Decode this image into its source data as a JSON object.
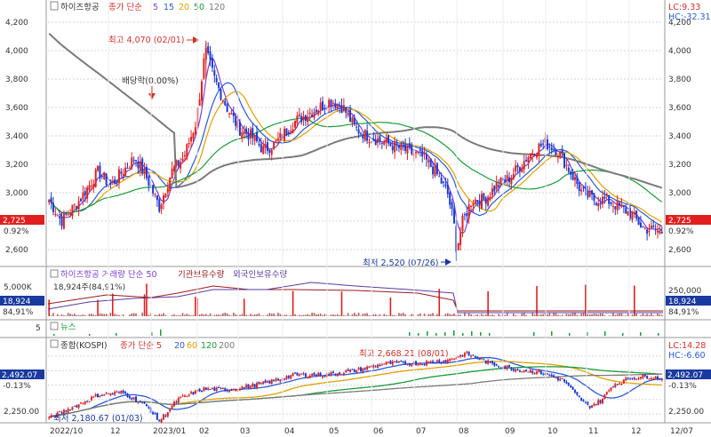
{
  "price": {
    "title": "하이즈항공",
    "ma_legend": [
      "종가 단순",
      "5",
      "15",
      "20",
      "50",
      "120"
    ],
    "ma_colors": {
      "5": "#7b3fd8",
      "15": "#2a5ad8",
      "20": "#e0a000",
      "50": "#1a9a3a",
      "120": "#7a7a7a"
    },
    "lc": "LC:9.33",
    "hc": "HC:-32.31",
    "current": "2,725",
    "change": "0.92%",
    "y_ticks": [
      "4,200",
      "4,000",
      "3,800",
      "3,600",
      "3,400",
      "3,200",
      "3,000",
      "2,800",
      "2,600"
    ],
    "high_label": "최고 4,070 (02/01)",
    "low_label": "최저 2,520 (07/26)",
    "dividend_label": "배당락(0.00%)"
  },
  "volume": {
    "legend": [
      "하이즈항공 거래량 단순 50",
      "기관보유수량",
      "외국인보유수량"
    ],
    "info": "18,924주(84,91%)",
    "tick_left": "5,000K",
    "tick_right": "250,000",
    "badge_vol": "18,924",
    "badge_pct": "84,91%"
  },
  "news": {
    "label": "뉴스",
    "tick": "5"
  },
  "index": {
    "title": "종합(KOSPI)",
    "legend": [
      "종가 단순 5",
      "20",
      "60",
      "120",
      "200"
    ],
    "legend_colors": [
      "#d0342c",
      "#2a5ad8",
      "#e0a000",
      "#1a9a3a",
      "#7a7a7a"
    ],
    "lc": "LC:14.28",
    "hc": "HC:-6.60",
    "current": "2,492.07",
    "change": "-0.13%",
    "tick_low": "2,250.00",
    "high_label": "최고 2,668.21 (08/01)",
    "low_label": "최저 2,180.67 (01/03)"
  },
  "x_axis": [
    "2022/10",
    "12",
    "2023/01",
    "02",
    "03",
    "04",
    "05",
    "06",
    "07",
    "08",
    "09",
    "10",
    "11",
    "12",
    "12/07"
  ],
  "chart_data": {
    "type": "candlestick",
    "title": "하이즈항공",
    "x_range": [
      "2022/10",
      "2023/12/07"
    ],
    "ylim": [
      2520,
      4250
    ],
    "high": {
      "date": "02/01",
      "value": 4070
    },
    "low": {
      "date": "07/26",
      "value": 2520
    },
    "last": 2725,
    "series": [
      {
        "name": "5",
        "color": "#7b3fd8"
      },
      {
        "name": "15",
        "color": "#2a5ad8"
      },
      {
        "name": "20",
        "color": "#e0a000"
      },
      {
        "name": "50",
        "color": "#1a9a3a"
      },
      {
        "name": "120",
        "color": "#7a7a7a"
      }
    ],
    "close_approx": {
      "months": [
        "2022/10",
        "12",
        "2023/01",
        "02",
        "03",
        "04",
        "05",
        "06",
        "07",
        "08",
        "09",
        "10",
        "11",
        "12"
      ],
      "values": [
        2850,
        3050,
        3100,
        3850,
        3400,
        3600,
        3400,
        3250,
        2750,
        2950,
        3350,
        3050,
        2950,
        2725
      ]
    }
  },
  "index_chart_data": {
    "type": "candlestick",
    "name": "KOSPI",
    "high": {
      "date": "08/01",
      "value": 2668.21
    },
    "low": {
      "date": "01/03",
      "value": 2180.67
    },
    "last": 2492.07
  }
}
